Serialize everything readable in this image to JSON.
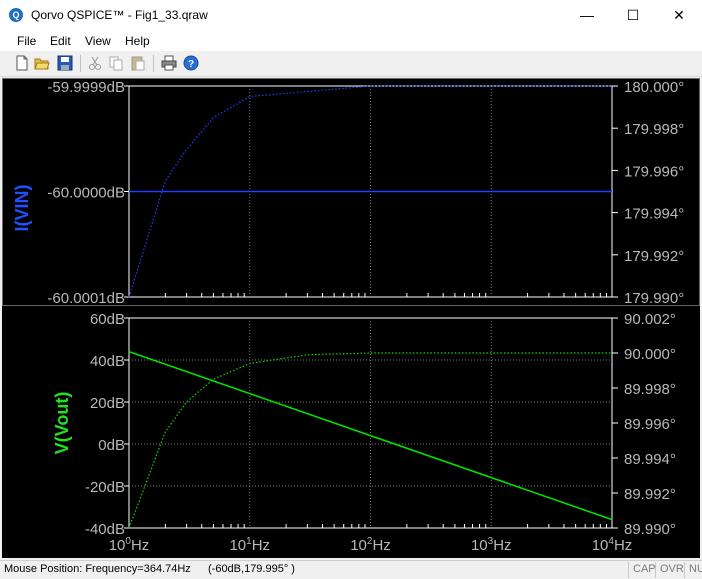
{
  "window": {
    "title": "Qorvo QSPICE™ - Fig1_33.qraw",
    "minimize_glyph": "—",
    "maximize_glyph": "☐",
    "close_glyph": "✕"
  },
  "menu": [
    "File",
    "Edit",
    "View",
    "Help"
  ],
  "toolbar": {
    "buttons": [
      "new-icon",
      "open-icon",
      "save-icon",
      "cut-icon",
      "copy-icon",
      "paste-icon",
      "print-icon",
      "help-icon"
    ]
  },
  "colors": {
    "plot_bg": "#000000",
    "grid": "#7a7a7a",
    "trace_top": "#2040ff",
    "trace_bottom": "#00e000",
    "axis_text": "#b8b8b8",
    "label_top": "#2050ff",
    "label_bottom": "#20e020"
  },
  "top_pane": {
    "trace_label": "I(VIN)",
    "left_ticks": [
      "-59.9999dB",
      "-60.0000dB",
      "-60.0001dB"
    ],
    "right_ticks": [
      "180.000°",
      "179.998°",
      "179.996°",
      "179.994°",
      "179.992°",
      "179.990°"
    ]
  },
  "bottom_pane": {
    "trace_label": "V(Vout)",
    "left_ticks": [
      "60dB",
      "40dB",
      "20dB",
      "0dB",
      "-20dB",
      "-40dB"
    ],
    "right_ticks": [
      "90.002°",
      "90.000°",
      "89.998°",
      "89.996°",
      "89.994°",
      "89.992°",
      "89.990°"
    ]
  },
  "x_axis": {
    "ticks": [
      {
        "base": "10",
        "exp": "0",
        "unit": "Hz"
      },
      {
        "base": "10",
        "exp": "1",
        "unit": "Hz"
      },
      {
        "base": "10",
        "exp": "2",
        "unit": "Hz"
      },
      {
        "base": "10",
        "exp": "3",
        "unit": "Hz"
      },
      {
        "base": "10",
        "exp": "4",
        "unit": "Hz"
      }
    ],
    "range_hz": [
      1,
      10000
    ],
    "scale": "log"
  },
  "chart_data": [
    {
      "type": "line",
      "title": "",
      "ylabel": "I(VIN)",
      "x_scale": "log",
      "xlim": [
        1,
        10000
      ],
      "ylim": [
        -60.0001,
        -59.9999
      ],
      "y2lim": [
        179.99,
        180.0
      ],
      "series": [
        {
          "name": "magnitude",
          "style": "solid",
          "x": [
            1,
            10000
          ],
          "values": [
            -60.0,
            -60.0
          ]
        },
        {
          "name": "phase",
          "style": "dotted",
          "axis": "right",
          "x": [
            1,
            2,
            3,
            5,
            10,
            100,
            10000
          ],
          "values": [
            179.99,
            179.9955,
            179.997,
            179.9985,
            179.9995,
            180.0,
            180.0
          ]
        }
      ]
    },
    {
      "type": "line",
      "title": "",
      "ylabel": "V(Vout)",
      "x_scale": "log",
      "xlim": [
        1,
        10000
      ],
      "ylim": [
        -40,
        60
      ],
      "y2lim": [
        89.99,
        90.002
      ],
      "series": [
        {
          "name": "magnitude",
          "style": "solid",
          "x": [
            1,
            10000
          ],
          "values": [
            44,
            -36
          ]
        },
        {
          "name": "phase",
          "style": "dotted",
          "axis": "right",
          "x": [
            1,
            2,
            3,
            5,
            10,
            30,
            100,
            10000
          ],
          "values": [
            89.99,
            89.9955,
            89.9972,
            89.9985,
            89.9994,
            89.9999,
            90.0,
            90.0
          ]
        }
      ]
    }
  ],
  "status": {
    "text": "Mouse Position: Frequency=364.74Hz",
    "coords": "(-60dB,179.995° )",
    "cap": "CAP",
    "ovr": "OVR",
    "num": "NUM"
  }
}
